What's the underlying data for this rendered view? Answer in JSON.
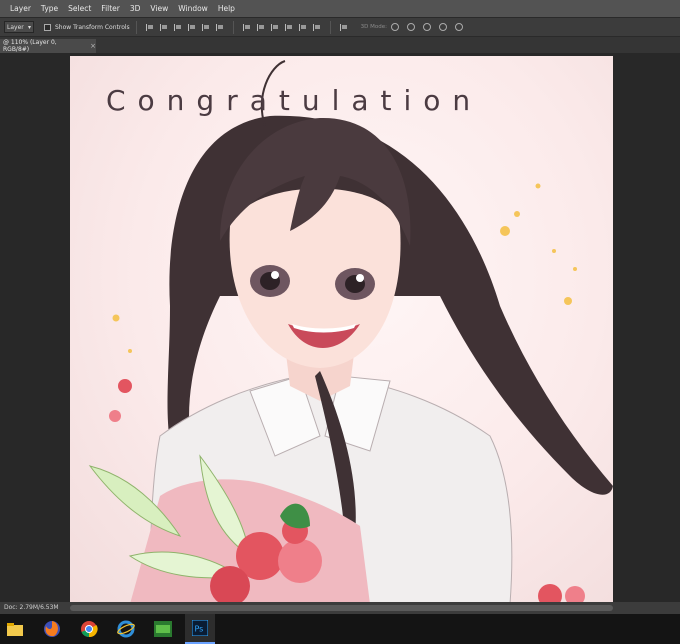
{
  "menubar": {
    "items": [
      "Layer",
      "Type",
      "Select",
      "Filter",
      "3D",
      "View",
      "Window",
      "Help"
    ]
  },
  "options": {
    "layer_select": "Layer",
    "show_transform_label": "Show Transform Controls",
    "mode_label": "3D Mode:"
  },
  "tab": {
    "title": "@ 110% (Layer 0, RGB/8#)",
    "close": "×"
  },
  "canvas": {
    "title": "Congratulation"
  },
  "status": {
    "doc_info": "Doc: 2.79M/6.53M"
  },
  "taskbar": {
    "apps": [
      "file-explorer-icon",
      "firefox-icon",
      "chrome-icon",
      "ie-icon",
      "sims-icon",
      "photoshop-icon"
    ]
  },
  "colors": {
    "menubar": "#535353",
    "workspace": "#282828",
    "accent": "#6aa2ff"
  }
}
